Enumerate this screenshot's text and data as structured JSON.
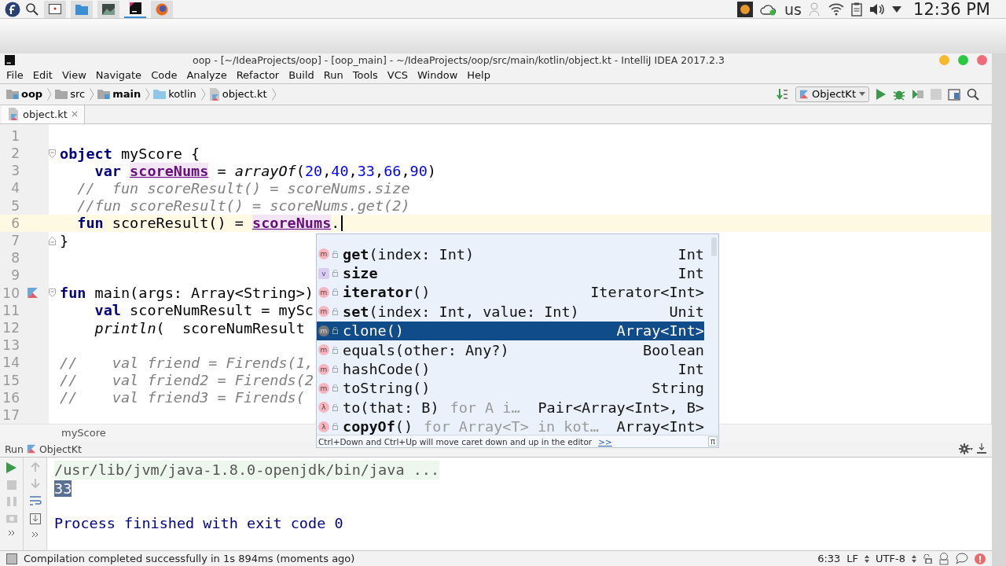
{
  "system_bar": {
    "taskbar": [
      {
        "kind": "terminal",
        "selected": false
      },
      {
        "kind": "files",
        "selected": false
      },
      {
        "kind": "image",
        "selected": false
      },
      {
        "kind": "ide",
        "selected": true
      },
      {
        "kind": "browser",
        "selected": false
      }
    ],
    "keyboard": "us",
    "clock": "12:36 PM"
  },
  "window": {
    "title": "oop - [~/IdeaProjects/oop] - [oop_main] - ~/IdeaProjects/oop/src/main/kotlin/object.kt - IntelliJ IDEA 2017.2.3"
  },
  "menu": [
    "File",
    "Edit",
    "View",
    "Navigate",
    "Code",
    "Analyze",
    "Refactor",
    "Build",
    "Run",
    "Tools",
    "VCS",
    "Window",
    "Help"
  ],
  "breadcrumbs": [
    {
      "kind": "module",
      "label": "oop"
    },
    {
      "kind": "folder",
      "label": "src"
    },
    {
      "kind": "module",
      "label": "main"
    },
    {
      "kind": "source",
      "label": "kotlin"
    },
    {
      "kind": "file",
      "label": "object.kt"
    }
  ],
  "run_config": "ObjectKt",
  "tabs": [
    {
      "label": "object.kt",
      "selected": true
    }
  ],
  "editor": {
    "lines": [
      {
        "number": "1",
        "current": false,
        "kind": "plain"
      },
      {
        "number": "2",
        "current": false,
        "kind": "fold-start",
        "tokens": [
          {
            "kind": "keyword",
            "text": "object"
          },
          {
            "kind": "plain",
            "text": " myScore {"
          }
        ]
      },
      {
        "number": "3",
        "current": false,
        "kind": "plain",
        "tokens": [
          {
            "kind": "keyword",
            "text": "    var "
          },
          {
            "kind": "field",
            "text": "scoreNums"
          },
          {
            "kind": "plain",
            "text": " = "
          },
          {
            "kind": "call",
            "text": "arrayOf"
          },
          {
            "kind": "plain",
            "text": "("
          },
          {
            "kind": "number",
            "text": "20"
          },
          {
            "kind": "plain",
            "text": ","
          },
          {
            "kind": "number",
            "text": "40"
          },
          {
            "kind": "plain",
            "text": ","
          },
          {
            "kind": "number",
            "text": "33"
          },
          {
            "kind": "plain",
            "text": ","
          },
          {
            "kind": "number",
            "text": "66"
          },
          {
            "kind": "plain",
            "text": ","
          },
          {
            "kind": "number",
            "text": "90"
          },
          {
            "kind": "plain",
            "text": ")"
          }
        ]
      },
      {
        "number": "4",
        "current": false,
        "kind": "plain",
        "tokens": [
          {
            "kind": "comment",
            "text": "  //  fun scoreResult() = scoreNums.size"
          }
        ]
      },
      {
        "number": "5",
        "current": false,
        "kind": "plain",
        "tokens": [
          {
            "kind": "comment",
            "text": "  //fun scoreResult() = scoreNums.get(2)"
          }
        ]
      },
      {
        "number": "6",
        "current": true,
        "kind": "plain",
        "tokens": [
          {
            "kind": "keyword",
            "text": "  fun "
          },
          {
            "kind": "plain",
            "text": "scoreResult() = "
          },
          {
            "kind": "field",
            "text": "scoreNums"
          },
          {
            "kind": "plain",
            "text": "."
          }
        ]
      },
      {
        "number": "7",
        "current": false,
        "kind": "fold-end",
        "tokens": [
          {
            "kind": "plain",
            "text": "}"
          }
        ]
      },
      {
        "number": "8",
        "current": false,
        "kind": "plain"
      },
      {
        "number": "9",
        "current": false,
        "kind": "plain"
      },
      {
        "number": "10",
        "current": false,
        "kind": "runnable",
        "tokens": [
          {
            "kind": "keyword",
            "text": "fun "
          },
          {
            "kind": "plain",
            "text": "main(args: Array<String>)"
          }
        ]
      },
      {
        "number": "11",
        "current": false,
        "kind": "plain",
        "tokens": [
          {
            "kind": "keyword",
            "text": "    val "
          },
          {
            "kind": "plain",
            "text": "scoreNumResult = mySc"
          }
        ]
      },
      {
        "number": "12",
        "current": false,
        "kind": "plain",
        "tokens": [
          {
            "kind": "call",
            "text": "    println"
          },
          {
            "kind": "plain",
            "text": "(  scoreNumResult"
          }
        ]
      },
      {
        "number": "13",
        "current": false,
        "kind": "plain"
      },
      {
        "number": "14",
        "current": false,
        "kind": "plain",
        "tokens": [
          {
            "kind": "comment",
            "text": "//    val friend = Firends(1,"
          }
        ]
      },
      {
        "number": "15",
        "current": false,
        "kind": "plain",
        "tokens": [
          {
            "kind": "comment",
            "text": "//    val friend2 = Firends(2"
          }
        ]
      },
      {
        "number": "16",
        "current": false,
        "kind": "plain",
        "tokens": [
          {
            "kind": "comment",
            "text": "//    val friend3 = Firends("
          }
        ]
      },
      {
        "number": "17",
        "current": false,
        "kind": "plain"
      }
    ],
    "breadcrumb": "myScore"
  },
  "completion": {
    "items": [
      {
        "kind": "method",
        "badge": "m",
        "label": "**get**(index: Int)",
        "type": "Int",
        "selected": false
      },
      {
        "kind": "value",
        "badge": "v",
        "label": "**size**",
        "type": "Int",
        "selected": false
      },
      {
        "kind": "method",
        "badge": "m",
        "label": "**iterator**()",
        "type": "Iterator<Int>",
        "selected": false
      },
      {
        "kind": "method",
        "badge": "m",
        "label": "**set**(index: Int, value: Int)",
        "type": "Unit",
        "selected": false
      },
      {
        "kind": "method",
        "badge": "m",
        "label": "clone()",
        "type": "Array<Int>",
        "selected": true
      },
      {
        "kind": "method",
        "badge": "m",
        "label": "equals(other: Any?)",
        "type": "Boolean",
        "selected": false
      },
      {
        "kind": "method",
        "badge": "m",
        "label": "hashCode()",
        "type": "Int",
        "selected": false
      },
      {
        "kind": "method",
        "badge": "m",
        "label": "toString()",
        "type": "String",
        "selected": false
      },
      {
        "kind": "lambda",
        "badge": "λ",
        "label": "to(that: B)",
        "hint": "for A i…",
        "type": "Pair<Array<Int>, B>",
        "selected": false
      },
      {
        "kind": "lambda",
        "badge": "λ",
        "label": "**copyOf**()",
        "hint": "for Array<T> in kot…",
        "type": "Array<Int>",
        "selected": false
      }
    ],
    "footer": "Ctrl+Down and Ctrl+Up will move caret down and up in the editor",
    "link": ">>",
    "corner_button": "π"
  },
  "run_panel": {
    "title": "Run",
    "config": "ObjectKt",
    "console": [
      {
        "kind": "command",
        "text": "/usr/lib/jvm/java-1.8.0-openjdk/bin/java ...",
        "selected": false
      },
      {
        "kind": "output",
        "text": "33",
        "selected": true
      },
      {
        "kind": "exit",
        "text": "Process finished with exit code 0",
        "selected": false
      }
    ]
  },
  "status_bar": {
    "message": "Compilation completed successfully in 1s 894ms (moments ago)",
    "position": "6:33",
    "line_separator": "LF",
    "encoding": "UTF-8"
  }
}
